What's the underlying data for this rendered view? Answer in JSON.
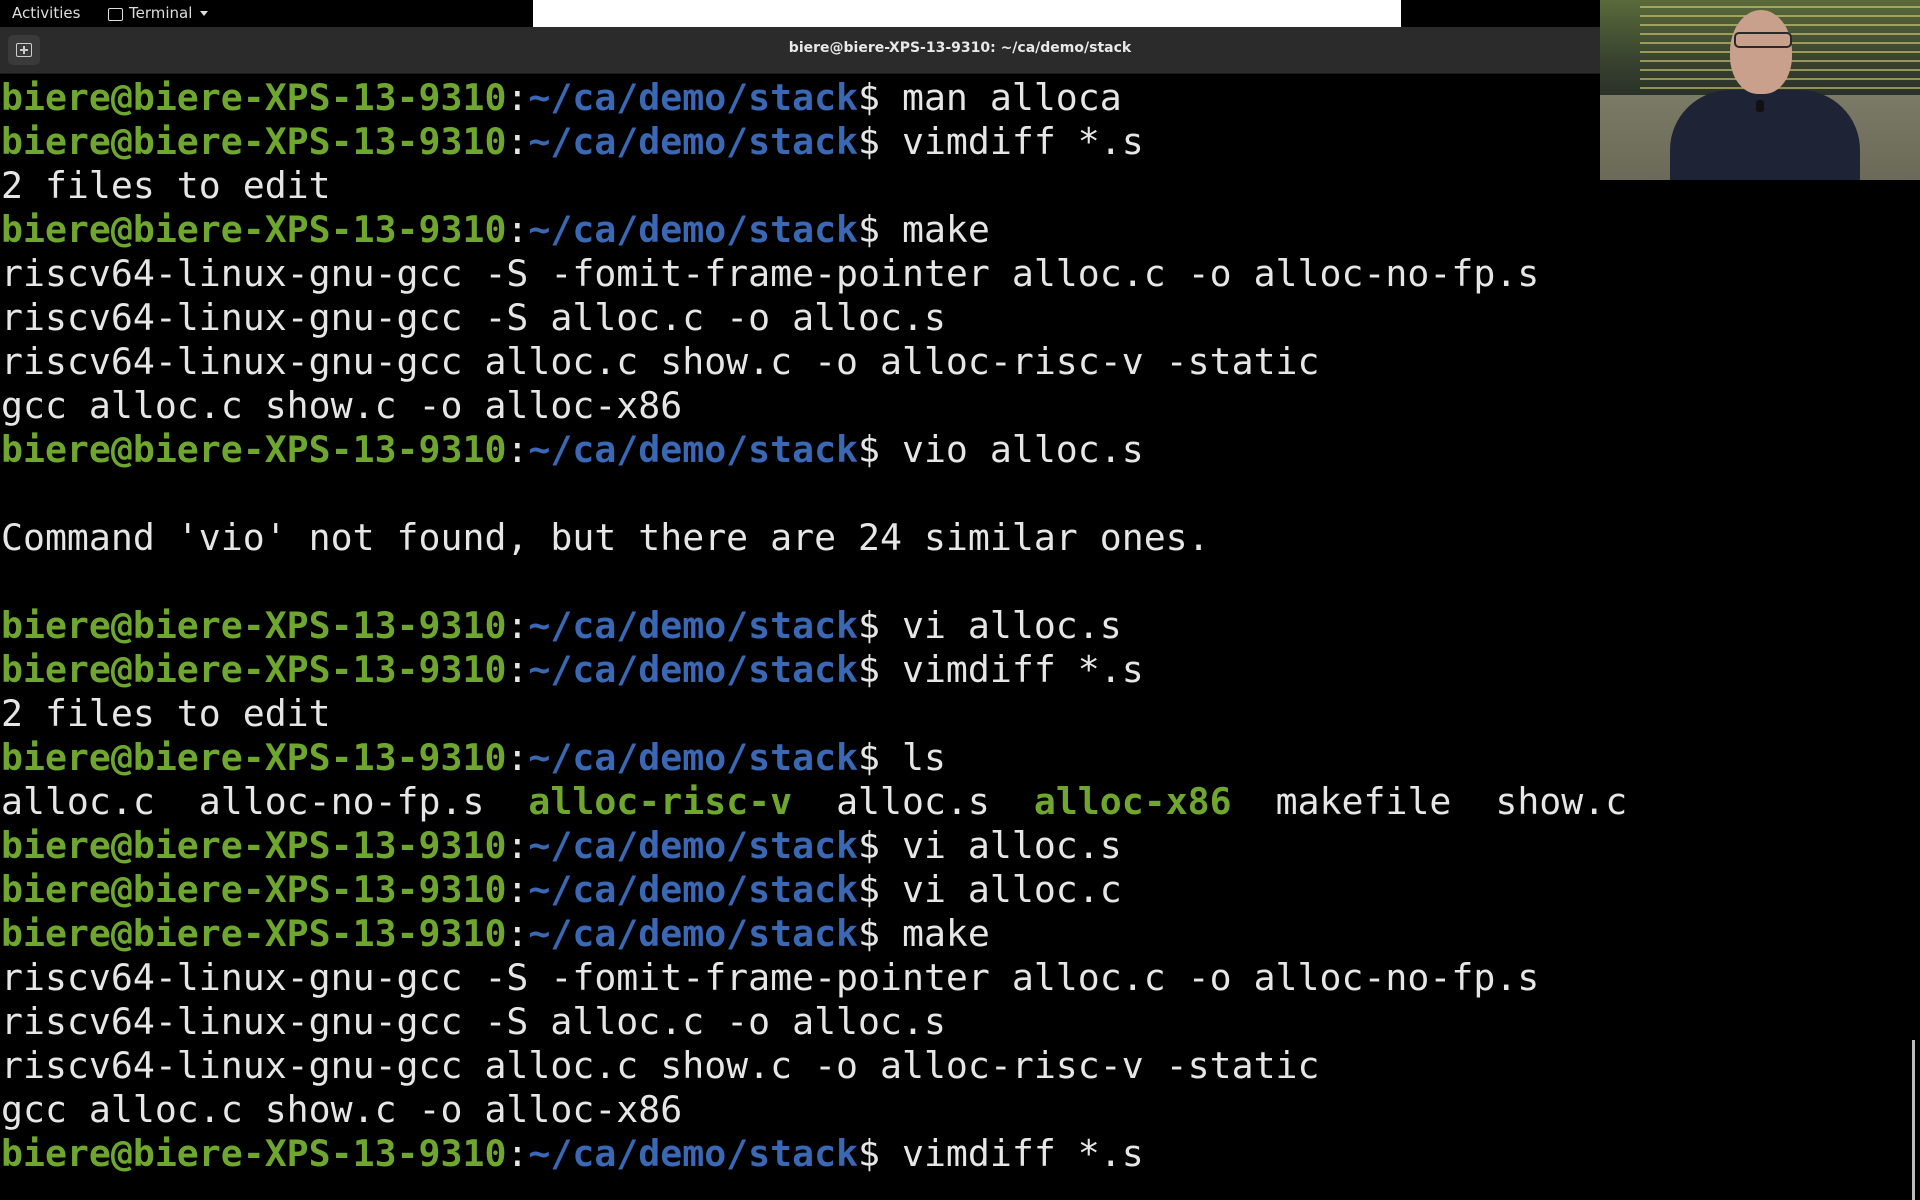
{
  "topbar": {
    "activities_label": "Activities",
    "app_menu_label": "Terminal"
  },
  "window": {
    "title": "biere@biere-XPS-13-9310: ~/ca/demo/stack"
  },
  "prompt": {
    "user_host": "biere@biere-XPS-13-9310",
    "sep": ":",
    "path": "~/ca/demo/stack",
    "dollar": "$ "
  },
  "colors": {
    "prompt_user": "#6fa72e",
    "prompt_path": "#3a68b4",
    "text": "#e6e6e6",
    "executable": "#6fa72e",
    "background": "#000000"
  },
  "terminal_lines": [
    {
      "type": "prompt",
      "cmd": "man alloca"
    },
    {
      "type": "prompt",
      "cmd": "vimdiff *.s"
    },
    {
      "type": "output",
      "text": "2 files to edit"
    },
    {
      "type": "prompt",
      "cmd": "make"
    },
    {
      "type": "output",
      "text": "riscv64-linux-gnu-gcc -S -fomit-frame-pointer alloc.c -o alloc-no-fp.s"
    },
    {
      "type": "output",
      "text": "riscv64-linux-gnu-gcc -S alloc.c -o alloc.s"
    },
    {
      "type": "output",
      "text": "riscv64-linux-gnu-gcc alloc.c show.c -o alloc-risc-v -static"
    },
    {
      "type": "output",
      "text": "gcc alloc.c show.c -o alloc-x86"
    },
    {
      "type": "prompt",
      "cmd": "vio alloc.s"
    },
    {
      "type": "output",
      "text": ""
    },
    {
      "type": "output",
      "text": "Command 'vio' not found, but there are 24 similar ones."
    },
    {
      "type": "output",
      "text": ""
    },
    {
      "type": "prompt",
      "cmd": "vi alloc.s"
    },
    {
      "type": "prompt",
      "cmd": "vimdiff *.s"
    },
    {
      "type": "output",
      "text": "2 files to edit"
    },
    {
      "type": "prompt",
      "cmd": "ls"
    },
    {
      "type": "ls",
      "items": [
        {
          "name": "alloc.c",
          "exe": false,
          "pad": "  "
        },
        {
          "name": "alloc-no-fp.s",
          "exe": false,
          "pad": "  "
        },
        {
          "name": "alloc-risc-v",
          "exe": true,
          "pad": "  "
        },
        {
          "name": "alloc.s",
          "exe": false,
          "pad": "  "
        },
        {
          "name": "alloc-x86",
          "exe": true,
          "pad": "  "
        },
        {
          "name": "makefile",
          "exe": false,
          "pad": "  "
        },
        {
          "name": "show.c",
          "exe": false,
          "pad": ""
        }
      ]
    },
    {
      "type": "prompt",
      "cmd": "vi alloc.s"
    },
    {
      "type": "prompt",
      "cmd": "vi alloc.c"
    },
    {
      "type": "prompt",
      "cmd": "make"
    },
    {
      "type": "output",
      "text": "riscv64-linux-gnu-gcc -S -fomit-frame-pointer alloc.c -o alloc-no-fp.s"
    },
    {
      "type": "output",
      "text": "riscv64-linux-gnu-gcc -S alloc.c -o alloc.s"
    },
    {
      "type": "output",
      "text": "riscv64-linux-gnu-gcc alloc.c show.c -o alloc-risc-v -static"
    },
    {
      "type": "output",
      "text": "gcc alloc.c show.c -o alloc-x86"
    },
    {
      "type": "prompt",
      "cmd": "vimdiff *.s"
    }
  ]
}
